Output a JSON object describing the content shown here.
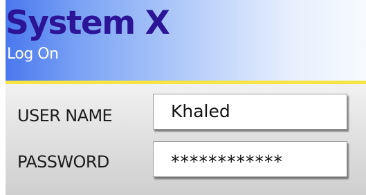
{
  "header": {
    "title": "System X",
    "subtitle": "Log On"
  },
  "form": {
    "username_label": "USER NAME",
    "username_value": "Khaled",
    "password_label": "PASSWORD",
    "password_masked": "************"
  },
  "colors": {
    "title": "#2b1596",
    "header_gradient_start": "#4a78ee",
    "header_gradient_end": "#f7faff",
    "accent_line": "#f5e442",
    "form_background": "#dedede"
  }
}
